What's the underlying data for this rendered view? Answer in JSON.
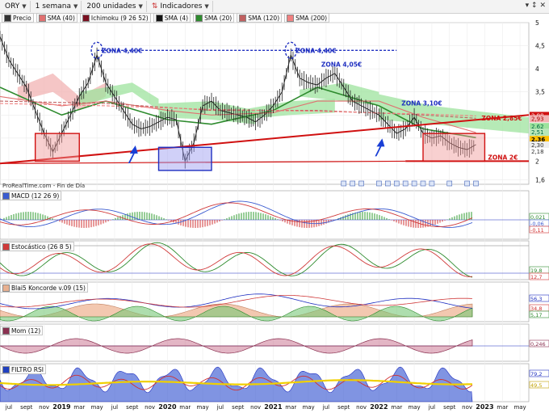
{
  "toolbar": {
    "symbol": "ORY",
    "period": "1 semana",
    "units": "200 unidades",
    "indicators": "Indicadores"
  },
  "legend": [
    {
      "label": "Precio",
      "color": "#333333"
    },
    {
      "label": "SMA (40)",
      "color": "#e07070"
    },
    {
      "label": "Ichimoku (9 26 52)",
      "color": "#7a1020"
    },
    {
      "label": "SMA (4)",
      "color": "#111111"
    },
    {
      "label": "SMA (20)",
      "color": "#2e8b2e"
    },
    {
      "label": "SMA (120)",
      "color": "#c06060"
    },
    {
      "label": "SMA (200)",
      "color": "#f08080"
    }
  ],
  "footer_text": "ProRealTime.com - Fin de Día",
  "panels": {
    "macd": "MACD (12 26 9)",
    "stoch": "Estocástico (26 8 5)",
    "blai5": "Blai5 Koncorde v.09 (15)",
    "mom": "Mom (12)",
    "rsi": "FILTRO RSI"
  },
  "annotations": {
    "zona440_a": "ZONA 4,40€",
    "zona440_b": "ZONA 4,40€",
    "zona405": "ZONA 4,05€",
    "zona310": "ZONA 3,10€",
    "zona285": "ZONA 2,85€",
    "zona2": "ZONA 2€"
  },
  "price_labels": {
    "p1": "2,98",
    "p2": "2,93",
    "p3": "2,62",
    "p4": "2,51",
    "last": "2,36",
    "p5": "2,30",
    "p6": "2,18"
  },
  "indicator_labels": {
    "macd_a": "0,021",
    "macd_b": "-0,06",
    "macd_c": "-0,11",
    "stoch_a": "19,8",
    "stoch_b": "12,7",
    "blai_a": "56,3",
    "blai_b": "34,8",
    "blai_c": "5,17",
    "mom": "0,246",
    "rsi_a": "79,2",
    "rsi_b": "49,5"
  },
  "colors": {
    "support": "#d01010",
    "resistance": "#1f2fc0",
    "kumo_green": "#9de39d",
    "kumo_red": "#f2b3b3",
    "arrow": "#1a3fd6"
  },
  "chart_data": {
    "type": "line",
    "title": "",
    "xlabel": "",
    "ylabel": "",
    "ylim": [
      1.5,
      5.0
    ],
    "y_ticks": [
      1.6,
      2,
      2.5,
      3,
      3.5,
      4,
      4.5,
      5
    ],
    "y_tick_labels": [
      "1,6",
      "2",
      "2,5",
      "3",
      "3,5",
      "4",
      "4,5",
      "5"
    ],
    "x_tick_labels": [
      "jul",
      "sept",
      "nov",
      "2019",
      "mar",
      "may",
      "jul",
      "sept",
      "nov",
      "2020",
      "mar",
      "may",
      "jul",
      "sept",
      "nov",
      "2021",
      "mar",
      "may",
      "jul",
      "sept",
      "nov",
      "2022",
      "mar",
      "may",
      "jul",
      "sept",
      "nov",
      "2023",
      "mar",
      "may"
    ],
    "x_tick_dates": [
      "2018-07",
      "2018-09",
      "2018-11",
      "2019-01",
      "2019-03",
      "2019-05",
      "2019-07",
      "2019-09",
      "2019-11",
      "2020-01",
      "2020-03",
      "2020-05",
      "2020-07",
      "2020-09",
      "2020-11",
      "2021-01",
      "2021-03",
      "2021-05",
      "2021-07",
      "2021-09",
      "2021-11",
      "2022-01",
      "2022-03",
      "2022-05",
      "2022-07",
      "2022-09",
      "2022-11",
      "2023-01",
      "2023-03",
      "2023-05"
    ],
    "x_range": [
      "2018-06",
      "2023-06"
    ],
    "series": [
      {
        "name": "Precio",
        "dates": [
          "2018-06",
          "2018-07",
          "2018-08",
          "2018-09",
          "2018-10",
          "2018-11",
          "2018-12",
          "2019-01",
          "2019-02",
          "2019-03",
          "2019-04",
          "2019-05",
          "2019-06",
          "2019-07",
          "2019-08",
          "2019-09",
          "2019-10",
          "2019-11",
          "2019-12",
          "2020-01",
          "2020-02",
          "2020-03",
          "2020-04",
          "2020-05",
          "2020-06",
          "2020-07",
          "2020-08",
          "2020-09",
          "2020-10",
          "2020-11",
          "2020-12",
          "2021-01",
          "2021-02",
          "2021-03",
          "2021-04",
          "2021-05",
          "2021-06",
          "2021-07",
          "2021-08",
          "2021-09",
          "2021-10",
          "2021-11",
          "2021-12",
          "2022-01",
          "2022-02",
          "2022-03",
          "2022-04",
          "2022-05",
          "2022-06",
          "2022-07",
          "2022-08",
          "2022-09",
          "2022-10",
          "2022-11",
          "2022-12"
        ],
        "values": [
          4.7,
          4.2,
          3.9,
          3.6,
          3.1,
          2.6,
          2.2,
          2.6,
          3.0,
          3.4,
          3.7,
          4.3,
          3.7,
          3.4,
          3.1,
          2.8,
          2.7,
          2.75,
          2.85,
          2.95,
          2.9,
          2.0,
          2.4,
          3.2,
          3.3,
          3.1,
          3.05,
          3.0,
          2.95,
          2.85,
          3.0,
          3.2,
          3.5,
          4.3,
          3.8,
          3.7,
          3.65,
          3.8,
          3.9,
          3.6,
          3.3,
          3.2,
          3.1,
          3.0,
          2.8,
          2.6,
          2.7,
          2.95,
          2.6,
          2.5,
          2.55,
          2.4,
          2.3,
          2.25,
          2.36
        ]
      },
      {
        "name": "SMA (20)",
        "dates": [
          "2018-06",
          "2019-01",
          "2019-06",
          "2020-01",
          "2020-06",
          "2021-01",
          "2021-06",
          "2022-01",
          "2022-06",
          "2022-12"
        ],
        "values": [
          3.6,
          3.0,
          3.3,
          2.9,
          2.8,
          3.1,
          3.6,
          3.2,
          2.7,
          2.51
        ]
      },
      {
        "name": "SMA (40)",
        "dates": [
          "2018-06",
          "2019-01",
          "2019-06",
          "2020-01",
          "2020-06",
          "2021-01",
          "2021-06",
          "2022-01",
          "2022-06",
          "2022-12"
        ],
        "values": [
          3.4,
          3.2,
          3.3,
          3.1,
          3.0,
          3.05,
          3.3,
          3.3,
          2.95,
          2.62
        ]
      },
      {
        "name": "SMA (120)",
        "dates": [
          "2018-06",
          "2019-06",
          "2020-06",
          "2021-06",
          "2022-06",
          "2022-12"
        ],
        "values": [
          3.3,
          3.25,
          3.1,
          3.1,
          3.0,
          2.93
        ]
      },
      {
        "name": "SMA (200)",
        "dates": [
          "2018-06",
          "2019-06",
          "2020-06",
          "2021-06",
          "2022-06",
          "2022-12"
        ],
        "values": [
          3.25,
          3.2,
          3.12,
          3.08,
          3.02,
          2.98
        ]
      }
    ],
    "horizontal_lines": [
      {
        "label": "ZONA 4,40€",
        "value": 4.4
      },
      {
        "label": "ZONA 2€",
        "value": 2.0
      }
    ],
    "trendline": {
      "label": "ZONA 2,85€",
      "from": [
        "2018-06",
        1.95
      ],
      "to": [
        "2023-06",
        3.0
      ]
    },
    "panels": [
      {
        "name": "MACD (12 26 9)",
        "last": [
          0.021,
          -0.06,
          -0.11
        ]
      },
      {
        "name": "Estocástico (26 8 5)",
        "last": [
          19.8,
          12.7
        ]
      },
      {
        "name": "Blai5 Koncorde v.09 (15)",
        "last": [
          56.3,
          34.8,
          5.17
        ]
      },
      {
        "name": "Mom (12)",
        "last": [
          0.246
        ]
      },
      {
        "name": "FILTRO RSI",
        "last": [
          79.2,
          49.5
        ]
      }
    ]
  }
}
